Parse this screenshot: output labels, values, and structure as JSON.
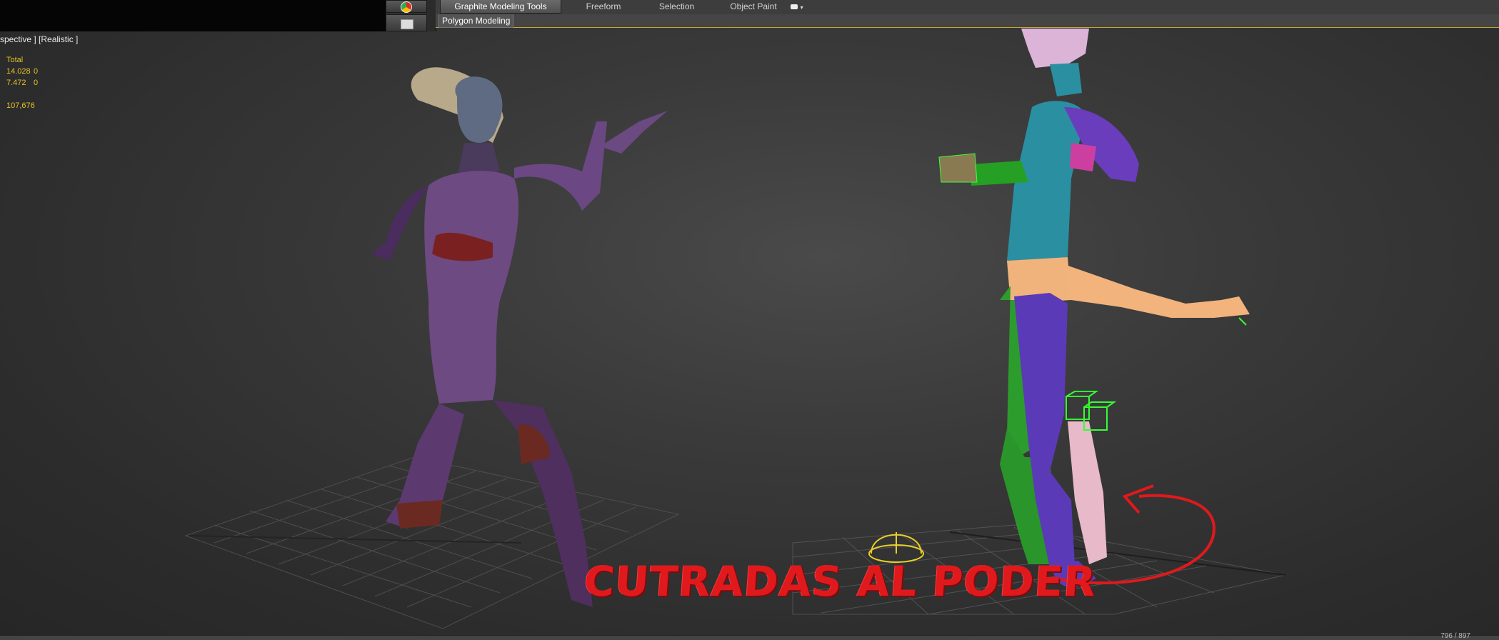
{
  "ribbon": {
    "tabs": [
      {
        "label": "Graphite Modeling Tools",
        "active": true
      },
      {
        "label": "Freeform",
        "active": false
      },
      {
        "label": "Selection",
        "active": false
      },
      {
        "label": "Object Paint",
        "active": false
      }
    ],
    "overflow_icon": "dropdown-toggle-icon",
    "subtab": "Polygon Modeling"
  },
  "viewport": {
    "label": "spective ] [Realistic ]",
    "stats": {
      "header": "Total",
      "rows": [
        {
          "value": "14.028",
          "selected": "0"
        },
        {
          "value": "7.472",
          "selected": "0"
        }
      ],
      "fps": "107,676"
    },
    "caption": "CUTRADAS AL PODER",
    "coords": "796 / 897"
  },
  "taskbar": {
    "icons": [
      "chrome-icon",
      "document-icon"
    ]
  },
  "colors": {
    "stats_text": "#e5c22a",
    "caption": "#e0191d",
    "ribbon_accent": "#c9a72c",
    "helper_wire": "#22ff22"
  }
}
